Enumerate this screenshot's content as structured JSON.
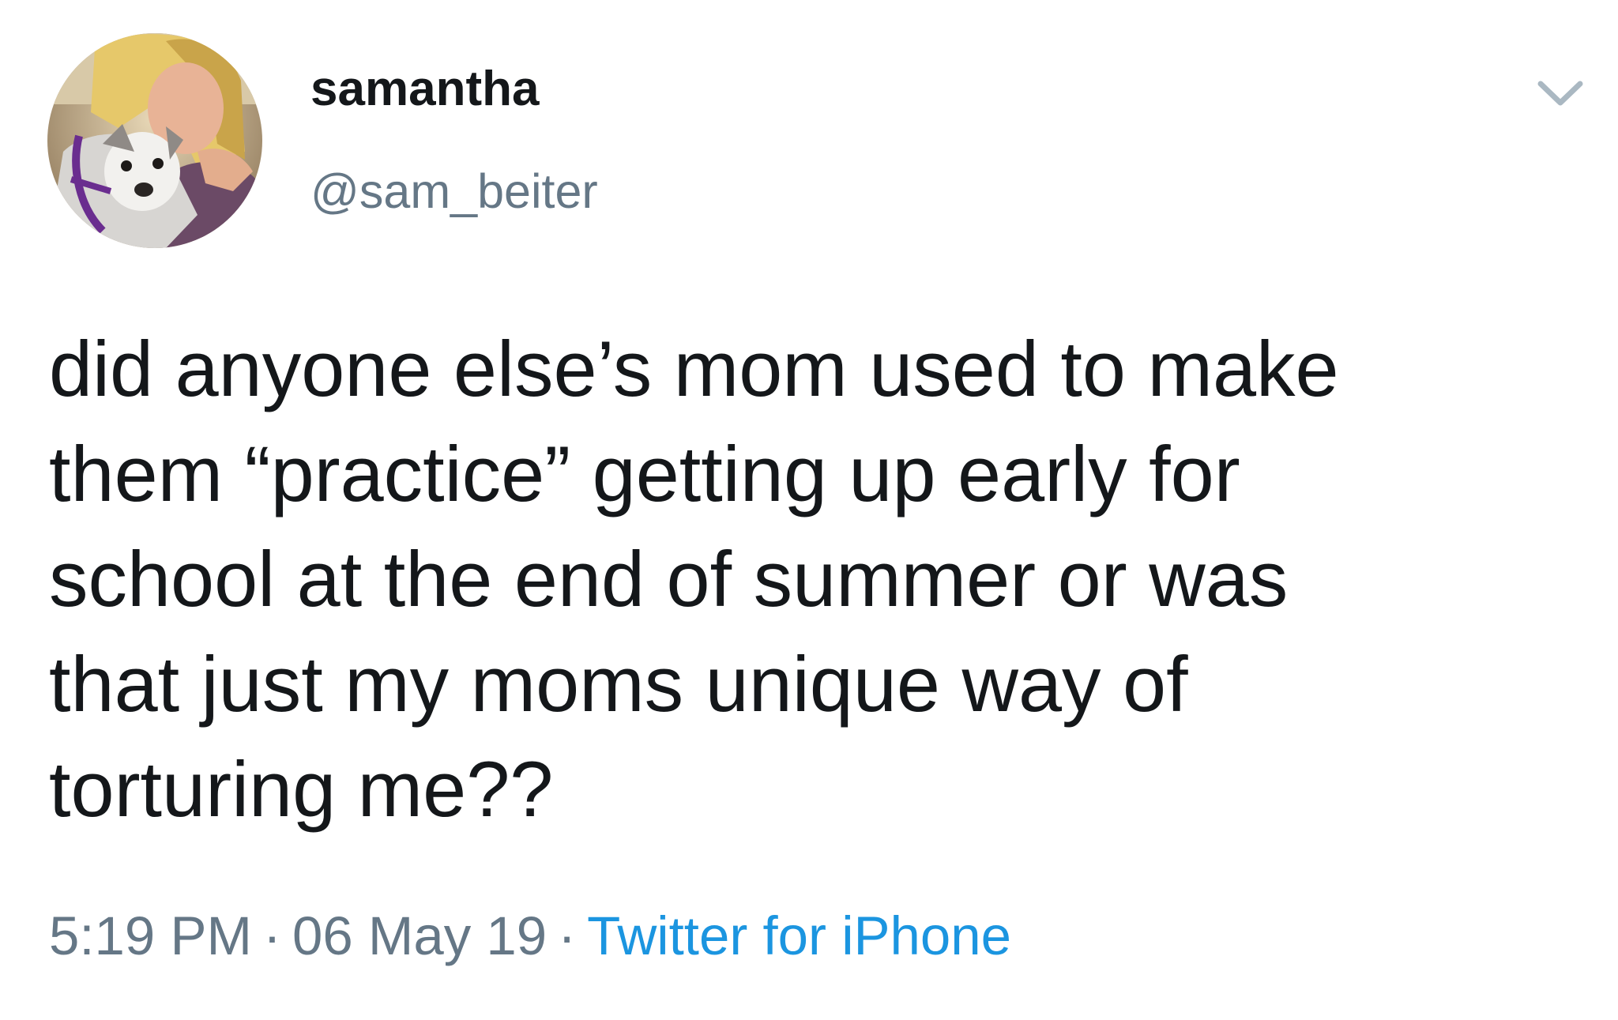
{
  "author": {
    "display_name": "samantha",
    "handle": "@sam_beiter"
  },
  "tweet": {
    "lines": [
      "did anyone else’s mom used to make",
      "them “practice” getting up early for",
      "school at the end of summer or was",
      "that just my moms unique way of",
      "torturing me??"
    ]
  },
  "meta": {
    "time": "5:19 PM",
    "separator": "·",
    "date": "06 May 19",
    "source": "Twitter for iPhone"
  },
  "icons": {
    "menu": "chevron-down-icon",
    "avatar": "profile-photo"
  },
  "colors": {
    "text": "#14171a",
    "secondary": "#657786",
    "link": "#1b95e0",
    "chevron": "#aab8c2"
  }
}
